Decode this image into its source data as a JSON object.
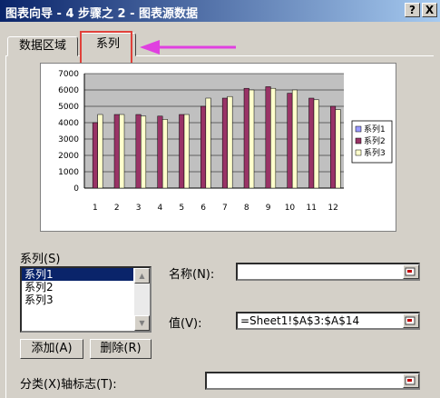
{
  "window": {
    "title": "图表向导 - 4 步骤之 2 - 图表源数据",
    "help": "?",
    "close": "X"
  },
  "tabs": [
    {
      "label": "数据区域"
    },
    {
      "label": "系列"
    }
  ],
  "annotations": {
    "highlight_color": "#e0413a",
    "arrow_color": "#e040e0"
  },
  "chart_data": {
    "type": "bar",
    "categories": [
      "1",
      "2",
      "3",
      "4",
      "5",
      "6",
      "7",
      "8",
      "9",
      "10",
      "11",
      "12"
    ],
    "series": [
      {
        "name": "系列1",
        "color": "#9999ff",
        "values": [
          0,
          0,
          0,
          0,
          0,
          0,
          0,
          0,
          0,
          0,
          0,
          0
        ]
      },
      {
        "name": "系列2",
        "color": "#993366",
        "values": [
          4000,
          4500,
          4500,
          4400,
          4500,
          5000,
          5500,
          6100,
          6200,
          5800,
          5500,
          5000
        ]
      },
      {
        "name": "系列3",
        "color": "#ffffcc",
        "values": [
          4500,
          4500,
          4400,
          4200,
          4500,
          5500,
          5600,
          6000,
          6100,
          6000,
          5400,
          4800
        ]
      }
    ],
    "yticks": [
      "0",
      "500",
      "1000",
      "1500",
      "2000",
      "2500",
      "3000",
      "3500",
      "4000",
      "4500",
      "5000",
      "5500",
      "6000",
      "6500",
      "7000"
    ],
    "ylim": [
      0,
      7000
    ],
    "grid": true,
    "legend": "right"
  },
  "series_section": {
    "label_main": "系列",
    "label_key": "(S)",
    "items": [
      "系列1",
      "系列2",
      "系列3"
    ],
    "selected_index": 0
  },
  "buttons": {
    "add_main": "添加",
    "add_key": "(A)",
    "delete_main": "删除",
    "delete_key": "(R)"
  },
  "name_field": {
    "label_main": "名称",
    "label_key": "(N)",
    "label_colon": ":",
    "value": ""
  },
  "value_field": {
    "label_main": "值",
    "label_key": "(V)",
    "label_colon": ":",
    "value": "=Sheet1!$A$3:$A$14"
  },
  "category_field": {
    "label_main": "分类",
    "label_key1": "(X)",
    "label_mid": "轴标志",
    "label_key2": "(T)",
    "label_colon": ":",
    "value": ""
  }
}
